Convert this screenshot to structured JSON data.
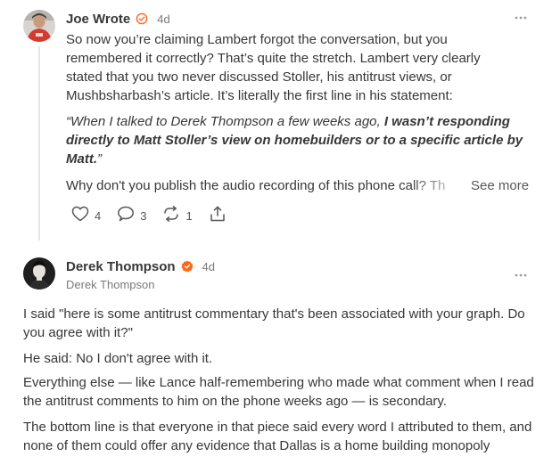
{
  "comment1": {
    "author": "Joe Wrote",
    "time": "4d",
    "body": "So now you’re claiming Lambert forgot the conversation, but you remembered it correctly? That’s quite the stretch. Lambert very clearly stated that you two never discussed Stoller, his antitrust views, or Mushbsharbash’s article. It’s literally the first line in his statement:",
    "quote_plain": "“When I talked to Derek Thompson a few weeks ago, ",
    "quote_bold": "I wasn’t responding directly to Matt Stoller’s view on homebuilders or to a specific article by Matt.",
    "quote_end": "”",
    "truncated_line": "Why don't you publish the audio recording of this phone call? Th",
    "see_more": "See more",
    "likes": "4",
    "replies": "3",
    "restacks": "1",
    "avatar_icon": "person-icon",
    "badge_icon": "verified-outline-icon",
    "more_icon": "ellipsis-icon"
  },
  "comment2": {
    "author": "Derek Thompson",
    "time": "4d",
    "subtitle": "Derek Thompson",
    "paragraphs": [
      "I said \"here is some antitrust commentary that's been associated with your graph. Do you agree with it?\"",
      "He said: No I don't agree with it.",
      "Everything else — like Lance half-remembering who made what comment when I read the antitrust comments to him on the phone weeks ago — is secondary.",
      "The bottom line is that everyone in that piece said every word I attributed to them, and none of them could offer any evidence that Dallas is a home building monopoly"
    ],
    "badge_icon": "verified-filled-icon"
  },
  "colors": {
    "accent": "#FF6719",
    "text": "#363737",
    "muted": "#7A7A7A",
    "thread_line": "#E6E6E6"
  }
}
